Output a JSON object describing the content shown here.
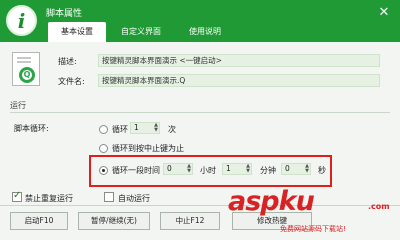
{
  "window": {
    "title": "脚本属性",
    "close_glyph": "✕",
    "app_icon_glyph": "i"
  },
  "tabs": [
    {
      "label": "基本设置",
      "active": true
    },
    {
      "label": "自定义界面",
      "active": false
    },
    {
      "label": "使用说明",
      "active": false
    }
  ],
  "script_info": {
    "file_icon_glyph": "Q",
    "description_label": "描述:",
    "description_value": "按键精灵脚本界面演示 <一键启动>",
    "filename_label": "文件名:",
    "filename_value": "按键精灵脚本界面演示.Q"
  },
  "run_section": {
    "title": "运行",
    "loop_label": "脚本循环:",
    "options": {
      "loop_count": {
        "label": "循环",
        "value": "1",
        "unit": "次",
        "checked": false
      },
      "until_stop": {
        "label": "循环到按中止键为止",
        "checked": false
      },
      "loop_duration": {
        "label": "循环一段时间",
        "hours_value": "0",
        "hours_unit": "小时",
        "minutes_value": "1",
        "minutes_unit": "分钟",
        "seconds_value": "0",
        "seconds_unit": "秒",
        "checked": true
      }
    },
    "disable_rerun": {
      "label": "禁止重复运行",
      "checked": true
    },
    "autorun": {
      "label": "自动运行",
      "checked": false
    }
  },
  "buttons": {
    "start": "启动F10",
    "pause": "暂停/继续(无)",
    "stop": "中止F12",
    "modify_hotkey": "修改热键"
  },
  "watermark": {
    "main": "aspku",
    "sub": ".com",
    "caption": "免费网站源码下载站!"
  },
  "colors": {
    "titlebar": "#1f9a35",
    "highlight_border": "#e01e1e",
    "watermark": "#d72323",
    "field_bg": "#e6f1e3"
  }
}
